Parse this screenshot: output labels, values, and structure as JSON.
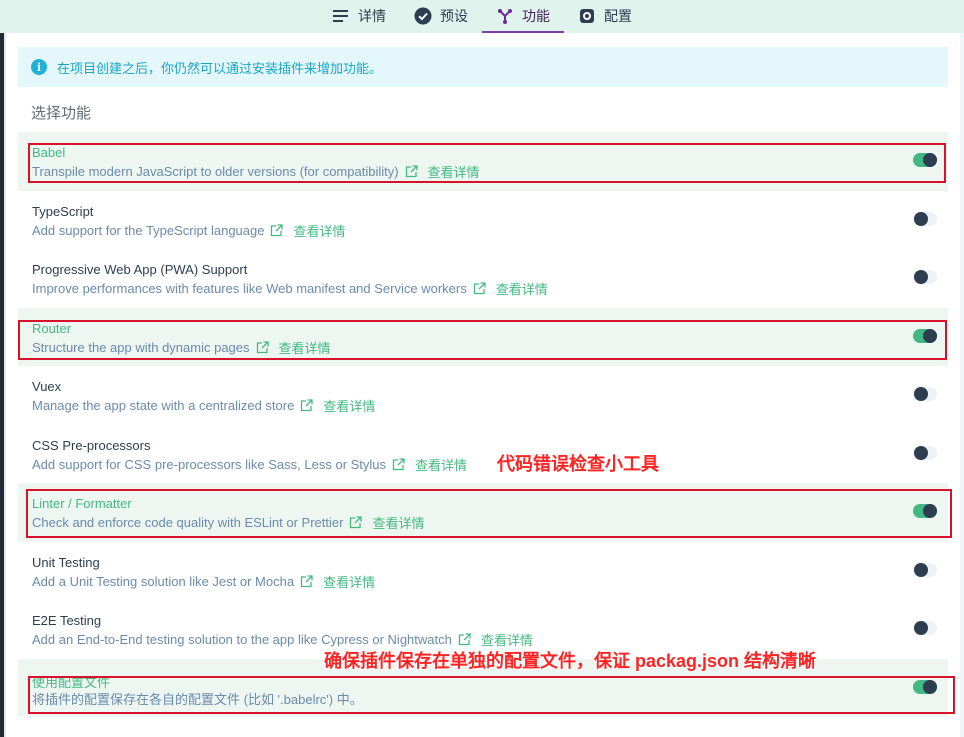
{
  "tabs": [
    {
      "label": "详情",
      "icon": "list-icon"
    },
    {
      "label": "预设",
      "icon": "check-circle-icon"
    },
    {
      "label": "功能",
      "icon": "feature-branch-icon"
    },
    {
      "label": "配置",
      "icon": "gear-icon"
    }
  ],
  "notice": {
    "icon": "info-icon",
    "text": "在项目创建之后，你仍然可以通过安装插件来增加功能。"
  },
  "section_title": "选择功能",
  "more_label": "查看详情",
  "features": [
    {
      "name": "Babel",
      "desc": "Transpile modern JavaScript to older versions (for compatibility)",
      "link": true,
      "enabled": true
    },
    {
      "name": "TypeScript",
      "desc": "Add support for the TypeScript language",
      "link": true,
      "enabled": false
    },
    {
      "name": "Progressive Web App (PWA) Support",
      "desc": "Improve performances with features like Web manifest and Service workers",
      "link": true,
      "enabled": false
    },
    {
      "name": "Router",
      "desc": "Structure the app with dynamic pages",
      "link": true,
      "enabled": true
    },
    {
      "name": "Vuex",
      "desc": "Manage the app state with a centralized store",
      "link": true,
      "enabled": false
    },
    {
      "name": "CSS Pre-processors",
      "desc": "Add support for CSS pre-processors like Sass, Less or Stylus",
      "link": true,
      "enabled": false
    },
    {
      "name": "Linter / Formatter",
      "desc": "Check and enforce code quality with ESLint or Prettier",
      "link": true,
      "enabled": true
    },
    {
      "name": "Unit Testing",
      "desc": "Add a Unit Testing solution like Jest or Mocha",
      "link": true,
      "enabled": false
    },
    {
      "name": "E2E Testing",
      "desc": "Add an End-to-End testing solution to the app like Cypress or Nightwatch",
      "link": true,
      "enabled": false
    },
    {
      "name": "使用配置文件",
      "desc": "将插件的配置保存在各自的配置文件 (比如 '.babelrc') 中。",
      "link": false,
      "enabled": true
    }
  ],
  "annotations": {
    "linter_note": "代码错误检查小工具",
    "config_note": "确保插件保存在单独的配置文件，保证 packag.json 结构清晰"
  },
  "colors": {
    "accent": "#42b983",
    "highlight_border": "#d9122b",
    "tab_active": "#7a3ea8",
    "info": "#1eb3d6"
  }
}
